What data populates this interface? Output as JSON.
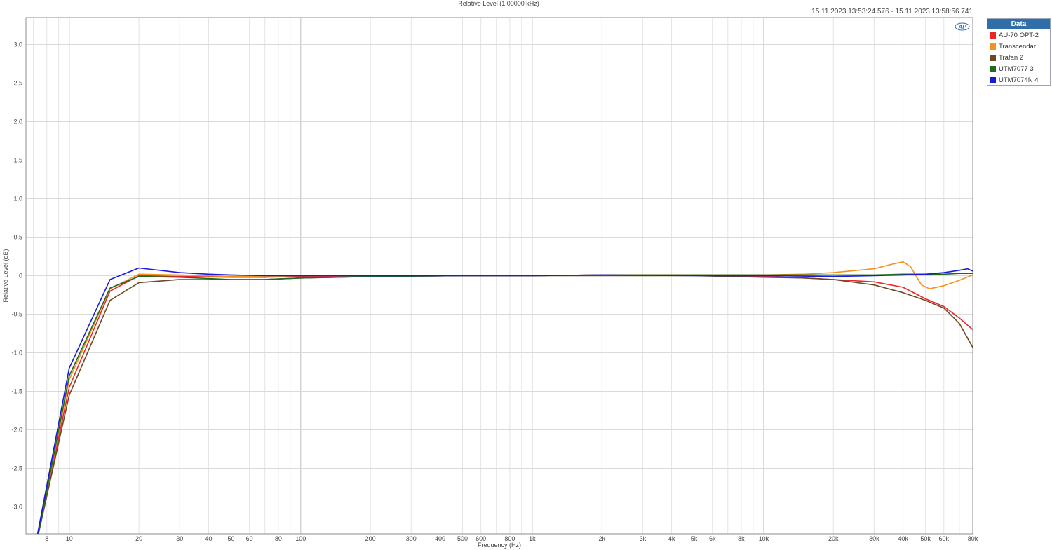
{
  "title": "Relative Level (1,00000 kHz)",
  "date_range": "15.11.2023 13:53:24.576 - 15.11.2023 13:58:56.741",
  "logo_text": "AP",
  "legend": {
    "header": "Data",
    "items": [
      {
        "label": "AU-70 OPT-2",
        "color": "#e8262b"
      },
      {
        "label": "Transcendar",
        "color": "#f5921e"
      },
      {
        "label": "Trafan  2",
        "color": "#6b4a22"
      },
      {
        "label": "UTM7077  3",
        "color": "#1e6b1e"
      },
      {
        "label": "UTM7074N  4",
        "color": "#1a1adc"
      }
    ]
  },
  "chart_data": {
    "type": "line",
    "title": "Relative Level (1,00000 kHz)",
    "xlabel": "Frequency (Hz)",
    "ylabel": "Relative Level (dB)",
    "x_scale": "log",
    "xlim": [
      6.5,
      80000
    ],
    "ylim": [
      -3.35,
      3.35
    ],
    "grid": true,
    "legend_position": "right",
    "x_major_ticks": [
      {
        "v": 8,
        "label": "8"
      },
      {
        "v": 10,
        "label": "10"
      },
      {
        "v": 20,
        "label": "20"
      },
      {
        "v": 30,
        "label": "30"
      },
      {
        "v": 40,
        "label": "40"
      },
      {
        "v": 50,
        "label": "50"
      },
      {
        "v": 60,
        "label": "60"
      },
      {
        "v": 80,
        "label": "80"
      },
      {
        "v": 100,
        "label": "100"
      },
      {
        "v": 200,
        "label": "200"
      },
      {
        "v": 300,
        "label": "300"
      },
      {
        "v": 400,
        "label": "400"
      },
      {
        "v": 500,
        "label": "500"
      },
      {
        "v": 600,
        "label": "600"
      },
      {
        "v": 800,
        "label": "800"
      },
      {
        "v": 1000,
        "label": "1k"
      },
      {
        "v": 2000,
        "label": "2k"
      },
      {
        "v": 3000,
        "label": "3k"
      },
      {
        "v": 4000,
        "label": "4k"
      },
      {
        "v": 5000,
        "label": "5k"
      },
      {
        "v": 6000,
        "label": "6k"
      },
      {
        "v": 8000,
        "label": "8k"
      },
      {
        "v": 10000,
        "label": "10k"
      },
      {
        "v": 20000,
        "label": "20k"
      },
      {
        "v": 30000,
        "label": "30k"
      },
      {
        "v": 40000,
        "label": "40k"
      },
      {
        "v": 50000,
        "label": "50k"
      },
      {
        "v": 60000,
        "label": "60k"
      },
      {
        "v": 80000,
        "label": "80k"
      }
    ],
    "y_ticks": [
      {
        "v": 3.0,
        "label": "3,0"
      },
      {
        "v": 2.5,
        "label": "2,5"
      },
      {
        "v": 2.0,
        "label": "2,0"
      },
      {
        "v": 1.5,
        "label": "1,5"
      },
      {
        "v": 1.0,
        "label": "1,0"
      },
      {
        "v": 0.5,
        "label": "0,5"
      },
      {
        "v": 0.0,
        "label": "0"
      },
      {
        "v": -0.5,
        "label": "-0,5"
      },
      {
        "v": -1.0,
        "label": "-1,0"
      },
      {
        "v": -1.5,
        "label": "-1,5"
      },
      {
        "v": -2.0,
        "label": "-2,0"
      },
      {
        "v": -2.5,
        "label": "-2,5"
      },
      {
        "v": -3.0,
        "label": "-3,0"
      }
    ],
    "series": [
      {
        "name": "AU-70 OPT-2",
        "color": "#e8262b",
        "points": [
          [
            7.3,
            -3.4
          ],
          [
            10,
            -1.45
          ],
          [
            15,
            -0.2
          ],
          [
            20,
            0.0
          ],
          [
            30,
            -0.01
          ],
          [
            50,
            -0.02
          ],
          [
            70,
            -0.02
          ],
          [
            100,
            -0.01
          ],
          [
            200,
            -0.01
          ],
          [
            500,
            0.0
          ],
          [
            1000,
            0.0
          ],
          [
            2000,
            0.01
          ],
          [
            5000,
            0.01
          ],
          [
            10000,
            -0.01
          ],
          [
            15000,
            -0.03
          ],
          [
            20000,
            -0.05
          ],
          [
            30000,
            -0.08
          ],
          [
            40000,
            -0.15
          ],
          [
            50000,
            -0.3
          ],
          [
            60000,
            -0.4
          ],
          [
            70000,
            -0.55
          ],
          [
            80000,
            -0.7
          ]
        ]
      },
      {
        "name": "Transcendar",
        "color": "#f5921e",
        "points": [
          [
            7.3,
            -3.4
          ],
          [
            10,
            -1.35
          ],
          [
            15,
            -0.17
          ],
          [
            20,
            0.02
          ],
          [
            30,
            0.01
          ],
          [
            50,
            -0.01
          ],
          [
            70,
            -0.01
          ],
          [
            100,
            0.0
          ],
          [
            200,
            0.0
          ],
          [
            500,
            0.0
          ],
          [
            1000,
            0.0
          ],
          [
            2000,
            0.01
          ],
          [
            5000,
            0.01
          ],
          [
            10000,
            0.01
          ],
          [
            15000,
            0.02
          ],
          [
            20000,
            0.04
          ],
          [
            30000,
            0.09
          ],
          [
            36000,
            0.15
          ],
          [
            40000,
            0.18
          ],
          [
            43000,
            0.12
          ],
          [
            48000,
            -0.12
          ],
          [
            52000,
            -0.17
          ],
          [
            60000,
            -0.13
          ],
          [
            70000,
            -0.06
          ],
          [
            80000,
            0.01
          ]
        ]
      },
      {
        "name": "Trafan  2",
        "color": "#6b4a22",
        "points": [
          [
            7.3,
            -3.4
          ],
          [
            10,
            -1.55
          ],
          [
            15,
            -0.32
          ],
          [
            20,
            -0.09
          ],
          [
            30,
            -0.05
          ],
          [
            50,
            -0.05
          ],
          [
            70,
            -0.05
          ],
          [
            100,
            -0.03
          ],
          [
            200,
            -0.01
          ],
          [
            500,
            0.0
          ],
          [
            1000,
            0.0
          ],
          [
            2000,
            0.0
          ],
          [
            5000,
            0.0
          ],
          [
            10000,
            -0.02
          ],
          [
            15000,
            -0.03
          ],
          [
            20000,
            -0.05
          ],
          [
            30000,
            -0.12
          ],
          [
            40000,
            -0.22
          ],
          [
            50000,
            -0.32
          ],
          [
            60000,
            -0.42
          ],
          [
            70000,
            -0.62
          ],
          [
            80000,
            -0.93
          ]
        ]
      },
      {
        "name": "UTM7077  3",
        "color": "#1e6b1e",
        "points": [
          [
            7.3,
            -3.4
          ],
          [
            10,
            -1.3
          ],
          [
            15,
            -0.16
          ],
          [
            20,
            -0.01
          ],
          [
            30,
            -0.02
          ],
          [
            50,
            -0.05
          ],
          [
            70,
            -0.05
          ],
          [
            100,
            -0.03
          ],
          [
            200,
            -0.01
          ],
          [
            500,
            0.0
          ],
          [
            1000,
            0.0
          ],
          [
            2000,
            0.01
          ],
          [
            5000,
            0.01
          ],
          [
            10000,
            0.01
          ],
          [
            20000,
            0.01
          ],
          [
            30000,
            0.01
          ],
          [
            40000,
            0.02
          ],
          [
            50000,
            0.02
          ],
          [
            60000,
            0.02
          ],
          [
            70000,
            0.03
          ],
          [
            80000,
            0.03
          ]
        ]
      },
      {
        "name": "UTM7074N  4",
        "color": "#1a1adc",
        "points": [
          [
            7.3,
            -3.35
          ],
          [
            10,
            -1.2
          ],
          [
            15,
            -0.05
          ],
          [
            20,
            0.1
          ],
          [
            30,
            0.04
          ],
          [
            40,
            0.02
          ],
          [
            50,
            0.01
          ],
          [
            70,
            0.0
          ],
          [
            100,
            0.0
          ],
          [
            200,
            0.0
          ],
          [
            500,
            0.0
          ],
          [
            1000,
            0.0
          ],
          [
            2000,
            0.01
          ],
          [
            5000,
            0.0
          ],
          [
            10000,
            0.0
          ],
          [
            20000,
            -0.01
          ],
          [
            30000,
            0.0
          ],
          [
            40000,
            0.01
          ],
          [
            50000,
            0.02
          ],
          [
            60000,
            0.04
          ],
          [
            70000,
            0.07
          ],
          [
            76000,
            0.09
          ],
          [
            80000,
            0.06
          ]
        ]
      }
    ]
  }
}
